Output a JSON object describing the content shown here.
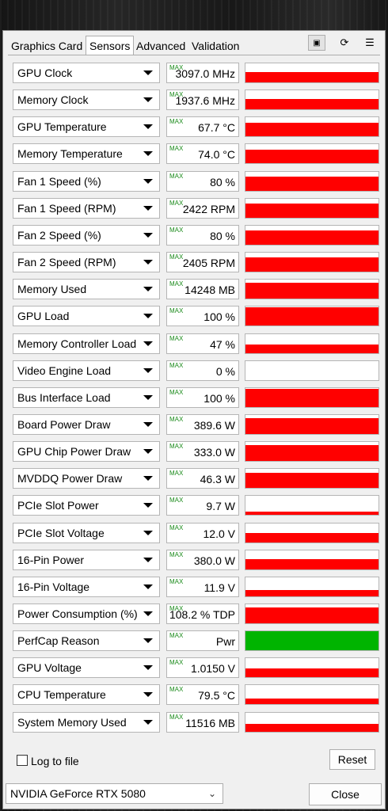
{
  "tabs": [
    "Graphics Card",
    "Sensors",
    "Advanced",
    "Validation"
  ],
  "active_tab": "Sensors",
  "toolbar_icons": [
    "camera-icon",
    "refresh-icon",
    "menu-icon"
  ],
  "colors": {
    "graph": "#ff0000",
    "perfcap": "#00b400",
    "max_tag": "#1a8a1a"
  },
  "max_tag": "MAX",
  "sensors": [
    {
      "label": "GPU Clock",
      "value": "3097.0 MHz",
      "level": 0.55
    },
    {
      "label": "Memory Clock",
      "value": "1937.6 MHz",
      "level": 0.55
    },
    {
      "label": "GPU Temperature",
      "value": "67.7 °C",
      "level": 0.7
    },
    {
      "label": "Memory Temperature",
      "value": "74.0 °C",
      "level": 0.7
    },
    {
      "label": "Fan 1 Speed (%)",
      "value": "80 %",
      "level": 0.75
    },
    {
      "label": "Fan 1 Speed (RPM)",
      "value": "2422 RPM",
      "level": 0.75
    },
    {
      "label": "Fan 2 Speed (%)",
      "value": "80 %",
      "level": 0.75
    },
    {
      "label": "Fan 2 Speed (RPM)",
      "value": "2405 RPM",
      "level": 0.75
    },
    {
      "label": "Memory Used",
      "value": "14248 MB",
      "level": 0.85
    },
    {
      "label": "GPU Load",
      "value": "100 %",
      "level": 0.95
    },
    {
      "label": "Memory Controller Load",
      "value": "47 %",
      "level": 0.45
    },
    {
      "label": "Video Engine Load",
      "value": "0 %",
      "level": 0
    },
    {
      "label": "Bus Interface Load",
      "value": "100 %",
      "level": 0.95
    },
    {
      "label": "Board Power Draw",
      "value": "389.6 W",
      "level": 0.85
    },
    {
      "label": "GPU Chip Power Draw",
      "value": "333.0 W",
      "level": 0.85
    },
    {
      "label": "MVDDQ Power Draw",
      "value": "46.3 W",
      "level": 0.8
    },
    {
      "label": "PCIe Slot Power",
      "value": "9.7 W",
      "level": 0.15
    },
    {
      "label": "PCIe Slot Voltage",
      "value": "12.0 V",
      "level": 0.5
    },
    {
      "label": "16-Pin Power",
      "value": "380.0 W",
      "level": 0.55
    },
    {
      "label": "16-Pin Voltage",
      "value": "11.9 V",
      "level": 0.35
    },
    {
      "label": "Power Consumption (%)",
      "value": "108.2 % TDP",
      "level": 0.85
    },
    {
      "label": "PerfCap Reason",
      "value": "Pwr",
      "level": 1.0,
      "color": "#00b400"
    },
    {
      "label": "GPU Voltage",
      "value": "1.0150 V",
      "level": 0.45
    },
    {
      "label": "CPU Temperature",
      "value": "79.5 °C",
      "level": 0.3
    },
    {
      "label": "System Memory Used",
      "value": "11516 MB",
      "level": 0.4
    }
  ],
  "log_to_file": "Log to file",
  "reset_label": "Reset",
  "gpu_select": "NVIDIA GeForce RTX 5080",
  "close_label": "Close"
}
